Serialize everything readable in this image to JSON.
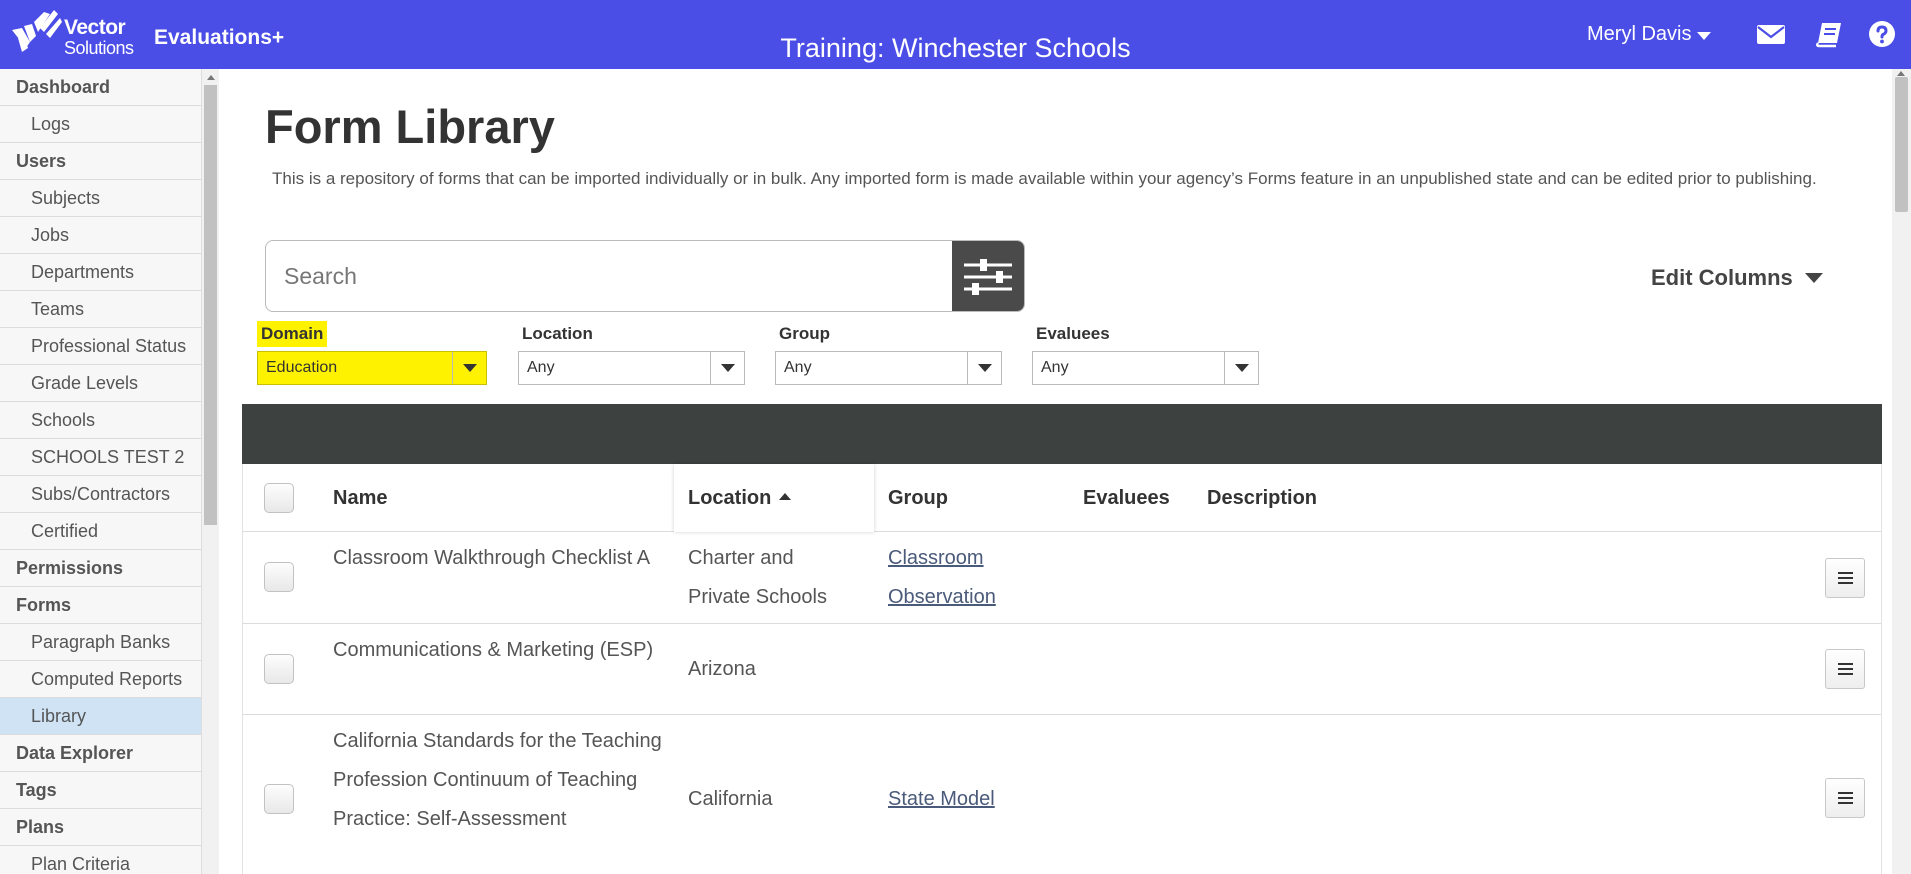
{
  "header": {
    "logo_line1": "Vector",
    "logo_line2": "Solutions",
    "app_name": "Evaluations+",
    "training_title": "Training: Winchester Schools",
    "user_name": "Meryl Davis",
    "icons": [
      "mail-icon",
      "book-icon",
      "help-icon"
    ],
    "accent_color": "#4a4de6"
  },
  "sidebar": {
    "items": [
      {
        "label": "Dashboard",
        "type": "section"
      },
      {
        "label": "Logs",
        "type": "sub"
      },
      {
        "label": "Users",
        "type": "section"
      },
      {
        "label": "Subjects",
        "type": "sub"
      },
      {
        "label": "Jobs",
        "type": "sub"
      },
      {
        "label": "Departments",
        "type": "sub"
      },
      {
        "label": "Teams",
        "type": "sub"
      },
      {
        "label": "Professional Status",
        "type": "sub"
      },
      {
        "label": "Grade Levels",
        "type": "sub"
      },
      {
        "label": "Schools",
        "type": "sub"
      },
      {
        "label": "SCHOOLS TEST 2",
        "type": "sub"
      },
      {
        "label": "Subs/Contractors",
        "type": "sub"
      },
      {
        "label": "Certified",
        "type": "sub"
      },
      {
        "label": "Permissions",
        "type": "section"
      },
      {
        "label": "Forms",
        "type": "section"
      },
      {
        "label": "Paragraph Banks",
        "type": "sub"
      },
      {
        "label": "Computed Reports",
        "type": "sub"
      },
      {
        "label": "Library",
        "type": "sub",
        "active": true
      },
      {
        "label": "Data Explorer",
        "type": "section"
      },
      {
        "label": "Tags",
        "type": "section"
      },
      {
        "label": "Plans",
        "type": "section"
      },
      {
        "label": "Plan Criteria",
        "type": "sub"
      }
    ]
  },
  "main": {
    "title": "Form Library",
    "description": "This is a repository of forms that can be imported individually or in bulk. Any imported form is made available within your agency’s Forms feature in an unpublished state and can be edited prior to publishing.",
    "search_placeholder": "Search",
    "edit_columns_label": "Edit Columns",
    "filters": [
      {
        "label": "Domain",
        "value": "Education",
        "highlighted": true
      },
      {
        "label": "Location",
        "value": "Any"
      },
      {
        "label": "Group",
        "value": "Any"
      },
      {
        "label": "Evaluees",
        "value": "Any"
      }
    ],
    "table": {
      "columns": [
        "Name",
        "Location",
        "Group",
        "Evaluees",
        "Description"
      ],
      "sorted_column": "Location",
      "rows": [
        {
          "name": "Classroom Walkthrough Checklist A",
          "location": "Charter and Private Schools",
          "group": "Classroom Observation",
          "evaluees": "",
          "description": ""
        },
        {
          "name": "Communications & Marketing (ESP)",
          "location": "Arizona",
          "group": "",
          "evaluees": "",
          "description": ""
        },
        {
          "name": "California Standards for the Teaching Profession Continuum of Teaching Practice: Self-Assessment",
          "location": "California",
          "group": "State Model",
          "evaluees": "",
          "description": ""
        }
      ]
    }
  },
  "highlight_color": "#fff200"
}
